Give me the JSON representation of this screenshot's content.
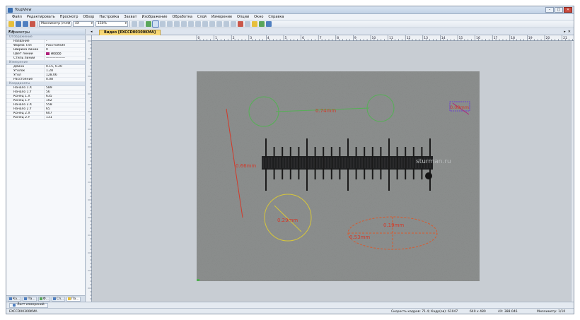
{
  "app": {
    "title": "ToupView",
    "window_controls": [
      "–",
      "□",
      "✕"
    ]
  },
  "menu": [
    "Файл",
    "Редактировать",
    "Просмотр",
    "Обзор",
    "Настройка",
    "Захват",
    "Изображение",
    "Обработка",
    "Слой",
    "Измерение",
    "Опции",
    "Окно",
    "Справка"
  ],
  "toolbar": {
    "unit_select": "Миллиметр (mm)",
    "objective_select": "4X",
    "zoom_select": "150%"
  },
  "panel": {
    "title": "Параметры",
    "sections": [
      {
        "title": "Отображение",
        "rows": [
          {
            "k": "Название",
            "v": "-"
          },
          {
            "k": "Форма Тип",
            "v": "Расстояние"
          },
          {
            "k": "Ширина линии",
            "v": "0"
          },
          {
            "k": "Цвет линии",
            "v": "ff0000",
            "color": "#b0207a"
          },
          {
            "k": "Стиль линии",
            "v": "——————"
          }
        ]
      },
      {
        "title": "Измерение",
        "rows": [
          {
            "k": "Длина",
            "v": "0.15, 0.20"
          },
          {
            "k": "Уголок",
            "v": "1.28"
          },
          {
            "k": "Угол",
            "v": "128.06"
          },
          {
            "k": "Расстояние",
            "v": "0.08"
          }
        ]
      },
      {
        "title": "Координаты",
        "rows": [
          {
            "k": "Начало 1.X",
            "v": "589"
          },
          {
            "k": "Начало 1.Y",
            "v": "56"
          },
          {
            "k": "Конец 1.X",
            "v": "635"
          },
          {
            "k": "Конец 1.Y",
            "v": "102"
          },
          {
            "k": "Начало 2.X",
            "v": "558"
          },
          {
            "k": "Начало 2.Y",
            "v": "65"
          },
          {
            "k": "Конец 2.X",
            "v": "607"
          },
          {
            "k": "Конец 2.Y",
            "v": "131"
          }
        ]
      }
    ],
    "tabs": [
      "Ка...",
      "Па...",
      "Ф...",
      "Сл...",
      "Па..."
    ]
  },
  "document": {
    "tab": "Видео [EXCCD00300KMA]"
  },
  "ruler": {
    "h_ticks": [
      "0",
      "1",
      "2",
      "3",
      "4",
      "5",
      "6",
      "7",
      "8",
      "9",
      "10",
      "11",
      "12",
      "13",
      "14",
      "15",
      "16",
      "17",
      "18",
      "19",
      "20",
      "21"
    ]
  },
  "image": {
    "watermark": "sturman.ru",
    "labels": {
      "distance_green": "0.74mm",
      "vertical_red": "0.66mm",
      "circle_yellow": "0.29mm",
      "ellipse_a": "0.53mm",
      "ellipse_b": "0.19mm",
      "box_purple": "0.08mm"
    }
  },
  "status": {
    "list_tab": "Лист измерений",
    "camera": "EXCCD00300KMA",
    "fps": "Скорость кадров: 71.4; Кадр(ов): 61047",
    "resolution": "640 x 480",
    "coords": "4X: 388.046",
    "scale": "Миллиметр: 1/10"
  },
  "colors": {
    "accent_tab": "#f7d775",
    "measure_red": "#d23a2a",
    "measure_green": "#4fae4f",
    "measure_yellow": "#d7c63a",
    "measure_purple": "#6c3fd0"
  }
}
